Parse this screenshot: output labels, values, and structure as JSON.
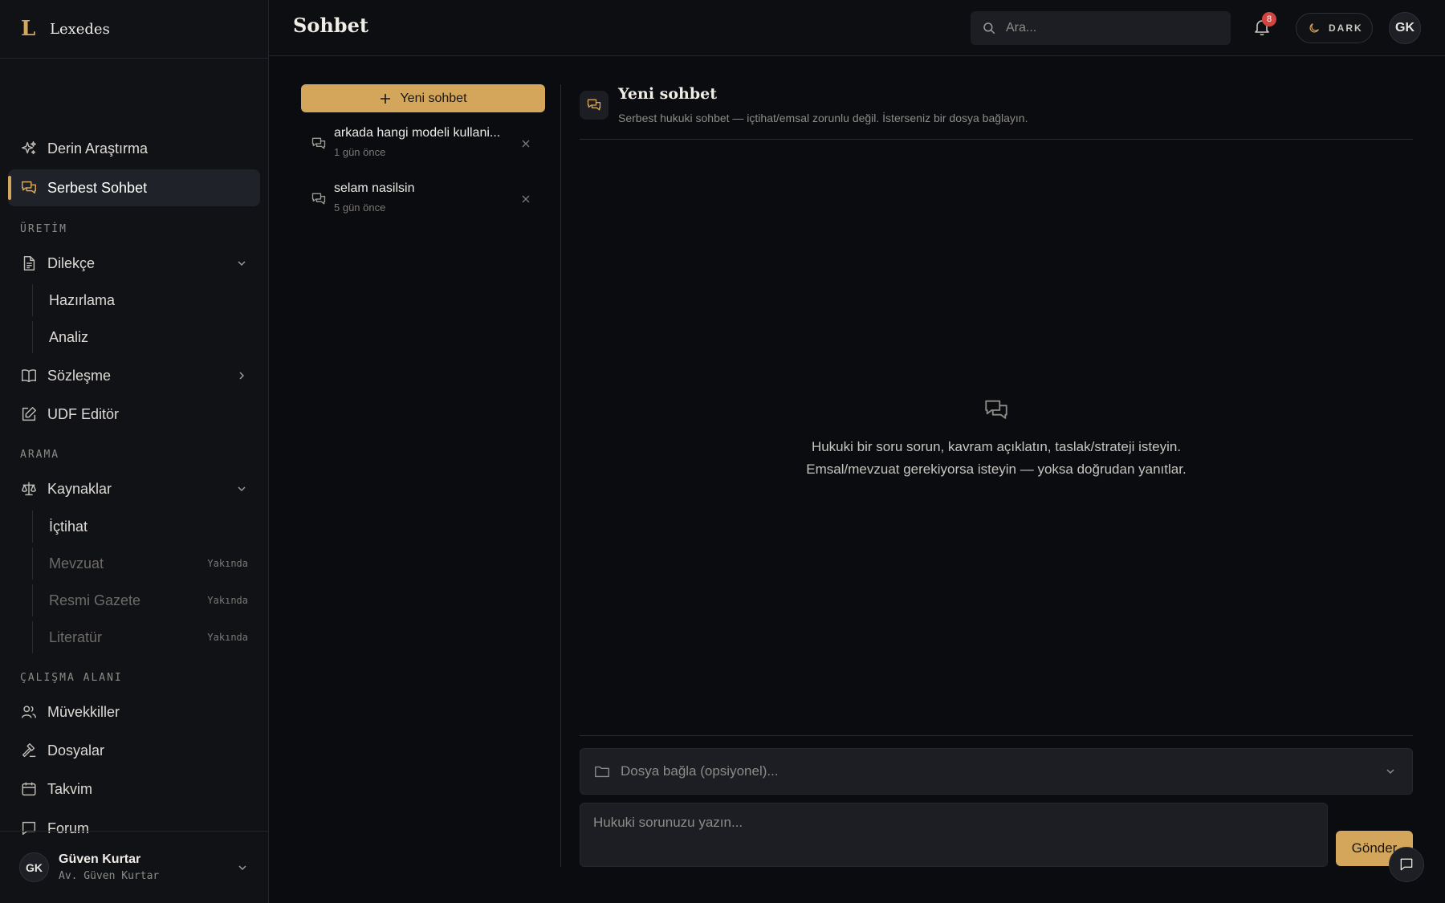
{
  "brand": {
    "logo": "L",
    "name": "Lexedes"
  },
  "header": {
    "title": "Sohbet",
    "search_placeholder": "Ara...",
    "notification_count": "8",
    "theme_label": "DARK",
    "avatar_initials": "GK"
  },
  "sidebar": {
    "top_items": [
      {
        "label": "Derin Araştırma",
        "icon": "sparkles-icon"
      },
      {
        "label": "Serbest Sohbet",
        "icon": "chat-icon",
        "active": true
      }
    ],
    "sections": {
      "production": {
        "title": "ÜRETİM",
        "items": [
          {
            "label": "Dilekçe",
            "icon": "document-icon",
            "expanded": true,
            "children": [
              {
                "label": "Hazırlama"
              },
              {
                "label": "Analiz"
              }
            ]
          },
          {
            "label": "Sözleşme",
            "icon": "book-icon",
            "expanded": false
          },
          {
            "label": "UDF Editör",
            "icon": "edit-icon"
          }
        ]
      },
      "search": {
        "title": "ARAMA",
        "items": [
          {
            "label": "Kaynaklar",
            "icon": "scale-icon",
            "expanded": true,
            "children": [
              {
                "label": "İçtihat"
              },
              {
                "label": "Mevzuat",
                "badge": "Yakında",
                "disabled": true
              },
              {
                "label": "Resmi Gazete",
                "badge": "Yakında",
                "disabled": true
              },
              {
                "label": "Literatür",
                "badge": "Yakında",
                "disabled": true
              }
            ]
          }
        ]
      },
      "workspace": {
        "title": "ÇALIŞMA ALANI",
        "items": [
          {
            "label": "Müvekkiller",
            "icon": "users-icon"
          },
          {
            "label": "Dosyalar",
            "icon": "gavel-icon"
          },
          {
            "label": "Takvim",
            "icon": "calendar-icon"
          },
          {
            "label": "Forum",
            "icon": "message-square-icon"
          }
        ]
      }
    },
    "user": {
      "initials": "GK",
      "name": "Güven Kurtar",
      "subtitle": "Av. Güven Kurtar"
    }
  },
  "conversations": {
    "new_button": "Yeni sohbet",
    "items": [
      {
        "title": "arkada hangi modeli kullani...",
        "time": "1 gün önce"
      },
      {
        "title": "selam nasilsin",
        "time": "5 gün önce"
      }
    ]
  },
  "chat": {
    "title": "Yeni sohbet",
    "subtitle": "Serbest hukuki sohbet — içtihat/emsal zorunlu değil. İsterseniz bir dosya bağlayın.",
    "empty_line1": "Hukuki bir soru sorun, kavram açıklatın, taslak/strateji isteyin.",
    "empty_line2": "Emsal/mevzuat gerekiyorsa isteyin — yoksa doğrudan yanıtlar.",
    "file_select_placeholder": "Dosya bağla (opsiyonel)...",
    "input_placeholder": "Hukuki sorunuzu yazın...",
    "send_label": "Gönder"
  },
  "colors": {
    "accent": "#d4a65c",
    "background": "#0b0c0f",
    "sidebar": "#111216",
    "badge": "#d0453f"
  }
}
